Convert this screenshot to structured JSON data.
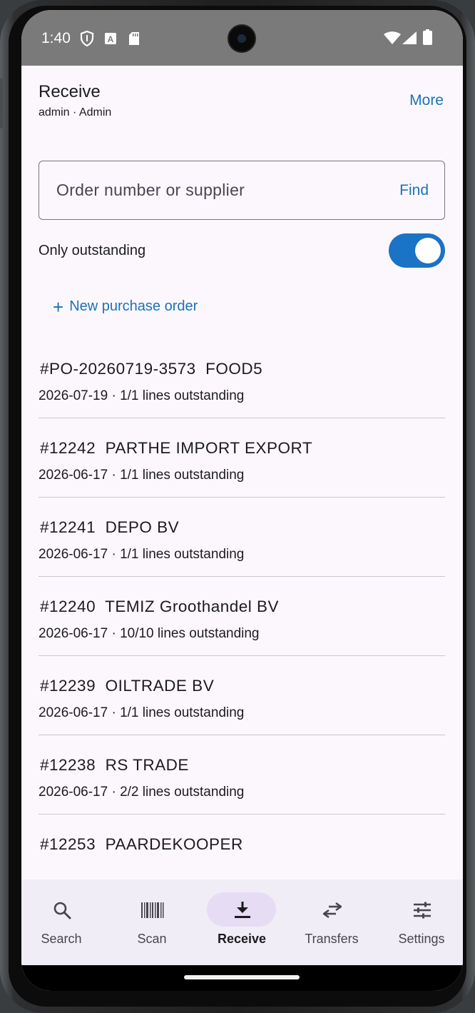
{
  "status_bar": {
    "time": "1:40",
    "icons": [
      "shield-icon",
      "a-icon",
      "sd-card-icon",
      "wifi-icon",
      "signal-icon",
      "battery-icon"
    ]
  },
  "header": {
    "title": "Receive",
    "subtitle": "admin · Admin",
    "more_label": "More"
  },
  "search": {
    "placeholder": "Order number or supplier",
    "value": "",
    "find_label": "Find"
  },
  "filter": {
    "only_outstanding_label": "Only outstanding",
    "only_outstanding_on": true
  },
  "new_po_label": "New purchase order",
  "orders": [
    {
      "title": "#PO-20260719-3573  FOOD5",
      "meta": "2026-07-19 · 1/1 lines outstanding"
    },
    {
      "title": "#12242  PARTHE IMPORT EXPORT",
      "meta": "2026-06-17 · 1/1 lines outstanding"
    },
    {
      "title": "#12241  DEPO BV",
      "meta": "2026-06-17 · 1/1 lines outstanding"
    },
    {
      "title": "#12240  TEMIZ Groothandel BV",
      "meta": "2026-06-17 · 10/10 lines outstanding"
    },
    {
      "title": "#12239  OILTRADE BV",
      "meta": "2026-06-17 · 1/1 lines outstanding"
    },
    {
      "title": "#12238  RS TRADE",
      "meta": "2026-06-17 · 2/2 lines outstanding"
    },
    {
      "title": "#12253  PAARDEKOOPER",
      "meta": ""
    }
  ],
  "nav": {
    "items": [
      {
        "label": "Search",
        "icon": "search-icon"
      },
      {
        "label": "Scan",
        "icon": "barcode-icon"
      },
      {
        "label": "Receive",
        "icon": "download-icon"
      },
      {
        "label": "Transfers",
        "icon": "swap-arrows-icon"
      },
      {
        "label": "Settings",
        "icon": "sliders-icon"
      }
    ],
    "active": "Receive"
  },
  "colors": {
    "accent": "#1a73b8",
    "toggle_on": "#1a73c6",
    "background": "#fcf7fd",
    "nav_background": "#f1edf6",
    "active_pill": "#e6dcf4"
  }
}
